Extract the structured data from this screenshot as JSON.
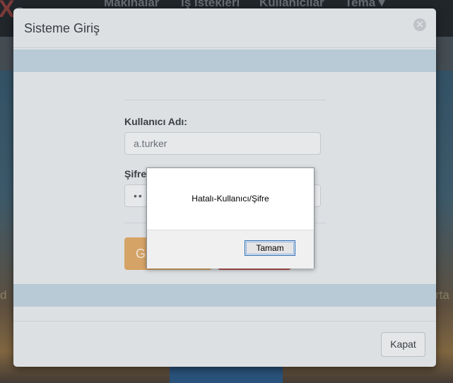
{
  "background": {
    "nav_items": [
      "Makinalar",
      "İş İstekleri",
      "Kullanıcılar",
      "Tema ▾"
    ],
    "side_left": "d",
    "side_right": "rta"
  },
  "modal": {
    "title": "Sisteme Giriş",
    "close_icon": "close-circle-icon",
    "username_label": "Kullanıcı Adı:",
    "username_value": "a.turker",
    "password_label": "Şifre",
    "password_value": "••",
    "login_button_label": "G",
    "close_button_label": "Kapat"
  },
  "alert": {
    "message": "Hatalı-Kullanıcı/Şifre",
    "ok_label": "Tamam"
  },
  "colors": {
    "band": "#b8cad6",
    "login_button": "#d5a366",
    "red_button": "#b7564f",
    "focus_border": "#2f6fb8"
  }
}
